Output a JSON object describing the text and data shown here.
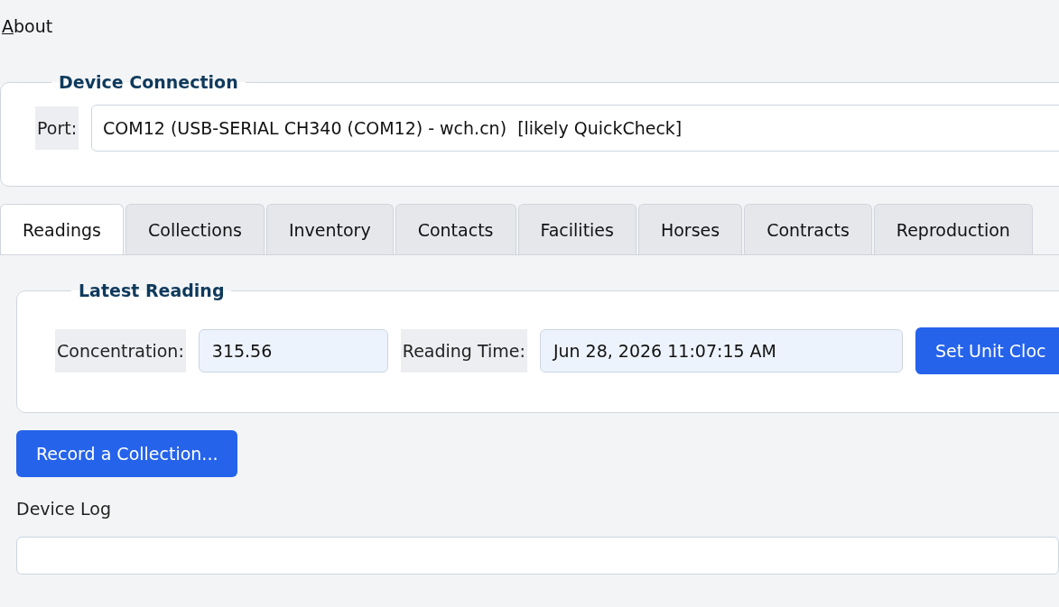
{
  "menu": [
    {
      "label": "About"
    }
  ],
  "device_connection": {
    "legend": "Device Connection",
    "port_label": "Port:",
    "port_value": "COM12 (USB-SERIAL CH340 (COM12) - wch.cn)  [likely QuickCheck]"
  },
  "tabs": [
    {
      "label": "Readings",
      "selected": true
    },
    {
      "label": "Collections",
      "selected": false
    },
    {
      "label": "Inventory",
      "selected": false
    },
    {
      "label": "Contacts",
      "selected": false
    },
    {
      "label": "Facilities",
      "selected": false
    },
    {
      "label": "Horses",
      "selected": false
    },
    {
      "label": "Contracts",
      "selected": false
    },
    {
      "label": "Reproduction",
      "selected": false
    }
  ],
  "latest_reading": {
    "legend": "Latest Reading",
    "concentration_label": "Concentration:",
    "concentration_value": "315.56",
    "time_label": "Reading Time:",
    "time_value": "Jun 28, 2026 11:07:15 AM",
    "button": "Set Unit Cloc"
  },
  "record_button": "Record a Collection...",
  "device_log": {
    "label": "Device Log"
  }
}
